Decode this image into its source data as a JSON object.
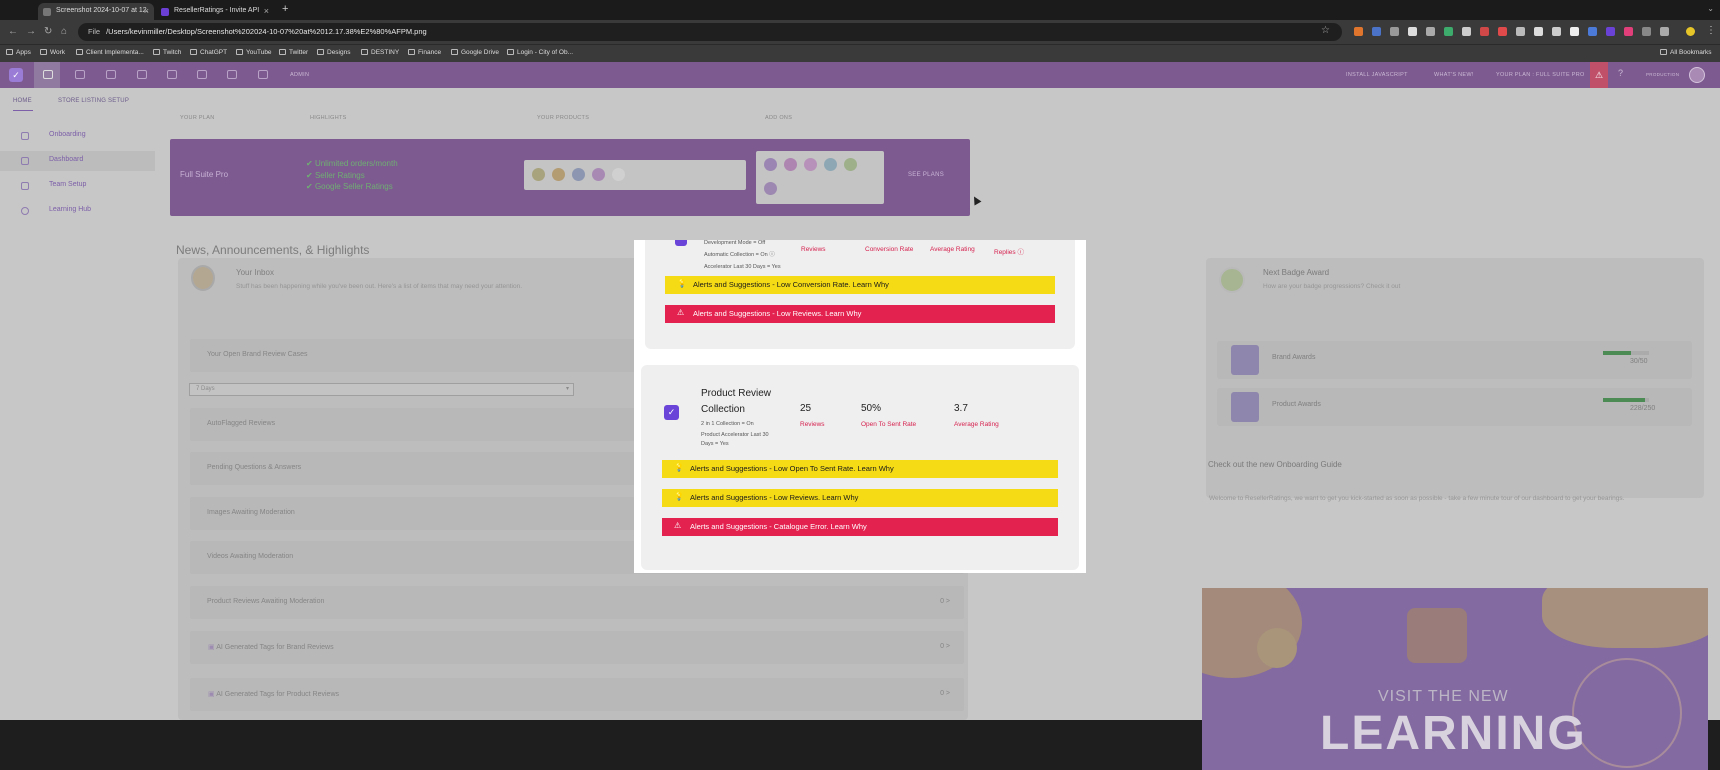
{
  "browser": {
    "tabs": [
      {
        "title": "Screenshot 2024-10-07 at 12.",
        "active": true
      },
      {
        "title": "ResellerRatings - Invite API",
        "active": false
      }
    ],
    "url_scheme": "File",
    "url": "/Users/kevinmiller/Desktop/Screenshot%202024-10-07%20at%2012.17.38%E2%80%AFPM.png",
    "bookmarks": [
      "Apps",
      "Work",
      "Client Implementa...",
      "Twitch",
      "ChatGPT",
      "YouTube",
      "Twitter",
      "Designs",
      "DESTINY",
      "Finance",
      "Google Drive",
      "Login - City of Ob..."
    ],
    "all_bookmarks": "All Bookmarks"
  },
  "topnav": {
    "admin": "ADMIN",
    "install": "INSTALL JAVASCRIPT",
    "whats_new": "WHAT'S NEW!",
    "plan": "YOUR PLAN : FULL SUITE PRO",
    "user": "PRODUCTION"
  },
  "subnav": {
    "home": "HOME",
    "store": "STORE LISTING SETUP"
  },
  "sidebar": {
    "items": [
      {
        "label": "Onboarding"
      },
      {
        "label": "Dashboard"
      },
      {
        "label": "Team Setup"
      },
      {
        "label": "Learning Hub"
      }
    ]
  },
  "plan_section": {
    "headers": [
      "YOUR PLAN",
      "HIGHLIGHTS",
      "YOUR PRODUCTS",
      "ADD ONS"
    ],
    "plan_name": "Full Suite Pro",
    "highlights": [
      "Unlimited orders/month",
      "Seller Ratings",
      "Google Seller Ratings"
    ],
    "see_plans": "SEE PLANS"
  },
  "news_title": "News, Announcements, & Highlights",
  "inbox": {
    "title": "Your Inbox",
    "subtitle": "Stuff has been happening while you've been out. Here's a list of items that may need your attention.",
    "open_cases": "Your Open Brand Review Cases",
    "period": "7 Days",
    "rows": [
      {
        "label": "AutoFlagged Reviews",
        "count": ""
      },
      {
        "label": "Pending Questions & Answers",
        "count": ""
      },
      {
        "label": "Images Awaiting Moderation",
        "count": ""
      },
      {
        "label": "Videos Awaiting Moderation",
        "count": ""
      },
      {
        "label": "Product Reviews Awaiting Moderation",
        "count": "0 >"
      },
      {
        "label": "AI Generated Tags for Brand Reviews",
        "count": "0 >"
      },
      {
        "label": "AI Generated Tags for Product Reviews",
        "count": "0 >"
      }
    ]
  },
  "badges": {
    "title": "Next Badge Award",
    "subtitle": "How are your badge progressions? Check it out",
    "items": [
      {
        "label": "Brand Awards",
        "value": "30/50",
        "progress": 0.6
      },
      {
        "label": "Product Awards",
        "value": "228/250",
        "progress": 0.91
      }
    ]
  },
  "onboarding_guide": {
    "title": "Check out the new Onboarding Guide",
    "text": "Welcome to ResellerRatings, we want to get you kick-started as soon as possible - take a few minute tour of our dashboard to get your bearings.",
    "image_line1": "VISIT THE NEW",
    "image_line2": "LEARNING"
  },
  "modal": {
    "top_card": {
      "lines": [
        "Development Mode = Off",
        "Automatic Collection = On ⓘ",
        "Accelerator Last 30 Days = Yes"
      ],
      "stat_labels": [
        "Reviews",
        "Conversion Rate",
        "Average Rating",
        "Replies ⓘ"
      ],
      "alerts": [
        {
          "text": "Alerts and Suggestions - Low Conversion Rate. Learn Why",
          "level": "warning"
        },
        {
          "text": "Alerts and Suggestions - Low Reviews. Learn Why",
          "level": "error"
        }
      ]
    },
    "product_card": {
      "title_line1": "Product Review",
      "title_line2": "Collection",
      "lines": [
        "2 in 1 Collection = On",
        "Product Accelerator Last 30",
        "Days = Yes"
      ],
      "stats": [
        {
          "value": "25",
          "label": "Reviews"
        },
        {
          "value": "50%",
          "label": "Open To Sent Rate"
        },
        {
          "value": "3.7",
          "label": "Average Rating"
        }
      ],
      "alerts": [
        {
          "text": "Alerts and Suggestions - Low Open To Sent Rate. Learn Why",
          "level": "warning"
        },
        {
          "text": "Alerts and Suggestions - Low Reviews. Learn Why",
          "level": "warning"
        },
        {
          "text": "Alerts and Suggestions - Catalogue Error. Learn Why",
          "level": "error"
        }
      ]
    }
  }
}
